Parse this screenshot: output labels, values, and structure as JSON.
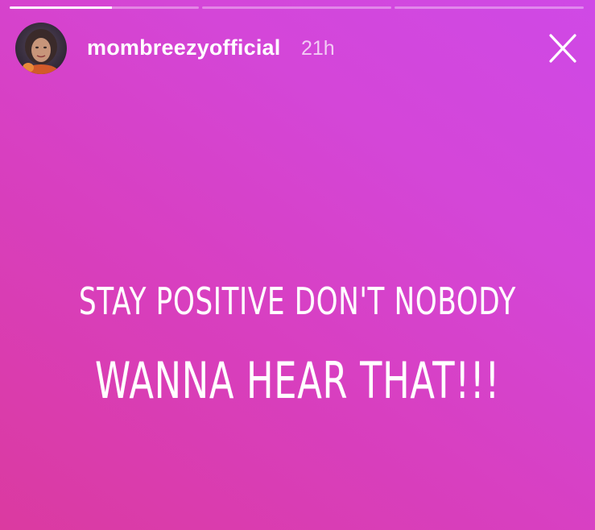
{
  "story": {
    "progress": [
      {
        "segment": 1,
        "fill_fraction": 0.54
      },
      {
        "segment": 2,
        "fill_fraction": 0.0
      },
      {
        "segment": 3,
        "fill_fraction": 0.0
      }
    ],
    "username": "mombreezyofficial",
    "timestamp": "21h",
    "text_lines": [
      "STAY POSITIVE DON'T NOBODY",
      "WANNA HEAR THAT!!!"
    ]
  },
  "icons": {
    "avatar": "profile-photo",
    "close": "close-x-icon"
  },
  "colors": {
    "background_start": "#db3aa0",
    "background_end": "#cf49e6",
    "text": "#ffffff"
  }
}
